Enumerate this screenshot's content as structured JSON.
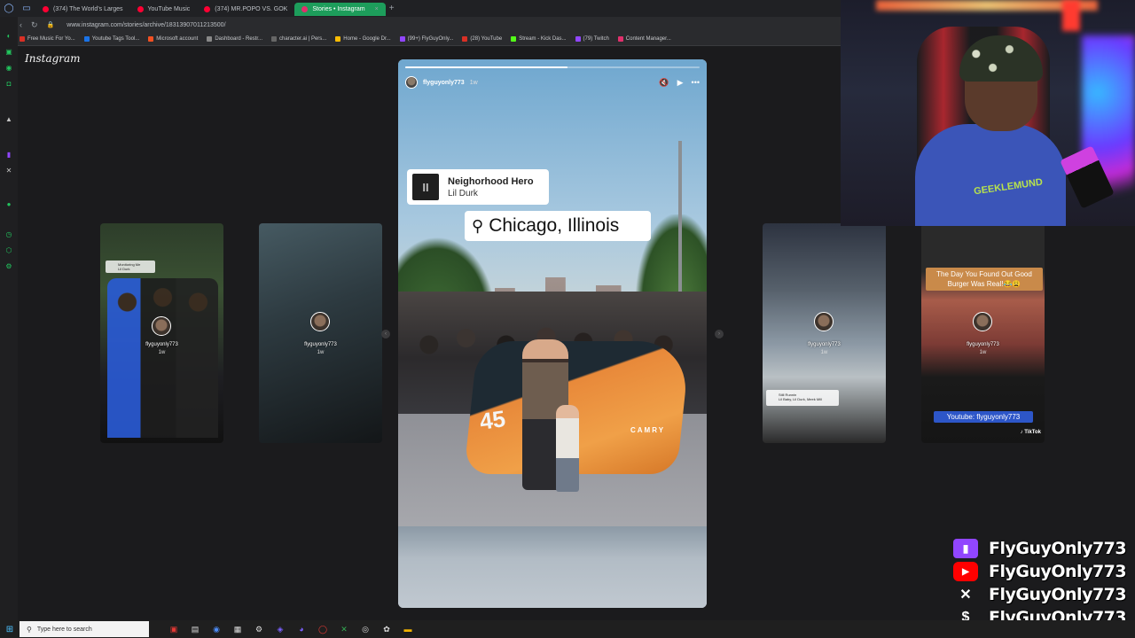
{
  "browser": {
    "tabs": [
      {
        "label": "(374) The World's Larges",
        "active": false
      },
      {
        "label": "YouTube Music",
        "active": false
      },
      {
        "label": "(374) MR.POPO VS. GOK",
        "active": false
      },
      {
        "label": "Stories • Instagram",
        "active": true
      }
    ],
    "new_tab": "+",
    "tab_close": "×",
    "url": "www.instagram.com/stories/archive/18313907011213500/",
    "bookmarks": [
      "Free Music For Yo...",
      "Youtube Tags Tool...",
      "Microsoft account",
      "Dashboard - Restr...",
      "character.ai | Pers...",
      "Home - Google Dr...",
      "(99+) FlyGuyOnly...",
      "(28) YouTube",
      "Stream - Kick Das...",
      "(79) Twitch",
      "Content Manager..."
    ]
  },
  "instagram": {
    "logo": "Instagram",
    "story": {
      "username": "flyguyonly773",
      "time": "1w",
      "progress": 0.55,
      "music": {
        "title": "Neighorhood Hero",
        "artist": "Lil Durk",
        "art_glyph": "II"
      },
      "location": "Chicago, Illinois",
      "car_number": "45",
      "car_brand": "CAMRY"
    },
    "previews": [
      {
        "username": "flyguyonly773",
        "time": "1w",
        "mini_title": "Monitoring Me",
        "mini_artist": "Lil Durk"
      },
      {
        "username": "flyguyonly773",
        "time": "1w"
      },
      {
        "username": "flyguyonly773",
        "time": "1w",
        "mini_title": "Still Runnin",
        "mini_artist": "Lil Baby, Lil Durk, Meek Mill"
      },
      {
        "username": "flyguyonly773",
        "time": "1w",
        "caption": "The Day You Found Out Good Burger Was Real!😂😩",
        "pill": "Youtube: flyguyonly773",
        "tiktok": "♪ TikTok"
      }
    ]
  },
  "webcam": {
    "shirt_text": "GEEKLEMUND"
  },
  "socials": [
    {
      "platform": "twitch",
      "icon": "twitch-icon",
      "name": "FlyGuyOnly773"
    },
    {
      "platform": "youtube",
      "icon": "youtube-icon",
      "name": "FlyGuyOnly773"
    },
    {
      "platform": "x",
      "icon": "x-icon",
      "name": "FlyGuyOnly773"
    },
    {
      "platform": "cashapp",
      "icon": "cashapp-icon",
      "name": "FlyGuyOnly773"
    }
  ],
  "taskbar": {
    "search_placeholder": "Type here to search"
  },
  "colors": {
    "active_tab": "#1d9d5b",
    "twitch": "#9146ff",
    "youtube": "#ff0000",
    "opera_green": "#22c55e"
  }
}
